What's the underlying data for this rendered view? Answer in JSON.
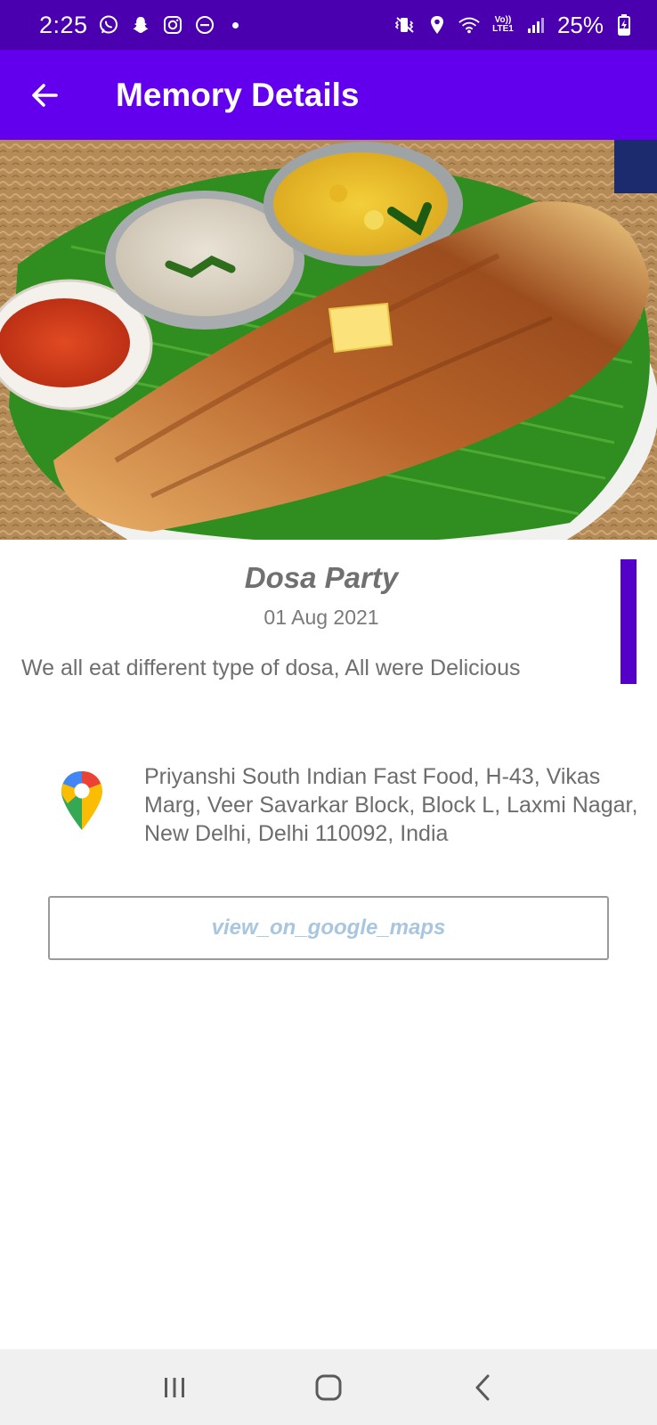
{
  "status_bar": {
    "time": "2:25",
    "battery": "25%",
    "left_icons": [
      "whatsapp-icon",
      "snapchat-icon",
      "instagram-icon",
      "dnd-icon"
    ],
    "network_label_top": "Vo))",
    "network_label_bottom": "LTE1"
  },
  "app_bar": {
    "title": "Memory Details",
    "back_icon": "arrow-left-icon",
    "color": "#6200ee"
  },
  "memory": {
    "title": "Dosa Party",
    "date": "01 Aug 2021",
    "description": "We all eat different type of dosa,  All were Delicious"
  },
  "location": {
    "icon": "google-maps-pin-icon",
    "address": "Priyanshi South Indian Fast Food, H-43, Vikas Marg, Veer Savarkar Block, Block L, Laxmi Nagar, New Delhi, Delhi 110092, India"
  },
  "actions": {
    "view_maps_label": "view_on_google_maps"
  },
  "nav_bar": {
    "buttons": [
      "recents-icon",
      "home-icon",
      "back-icon"
    ]
  },
  "colors": {
    "status_bar": "#4b00b0",
    "app_bar": "#6200ee",
    "accent": "#5500c8"
  }
}
